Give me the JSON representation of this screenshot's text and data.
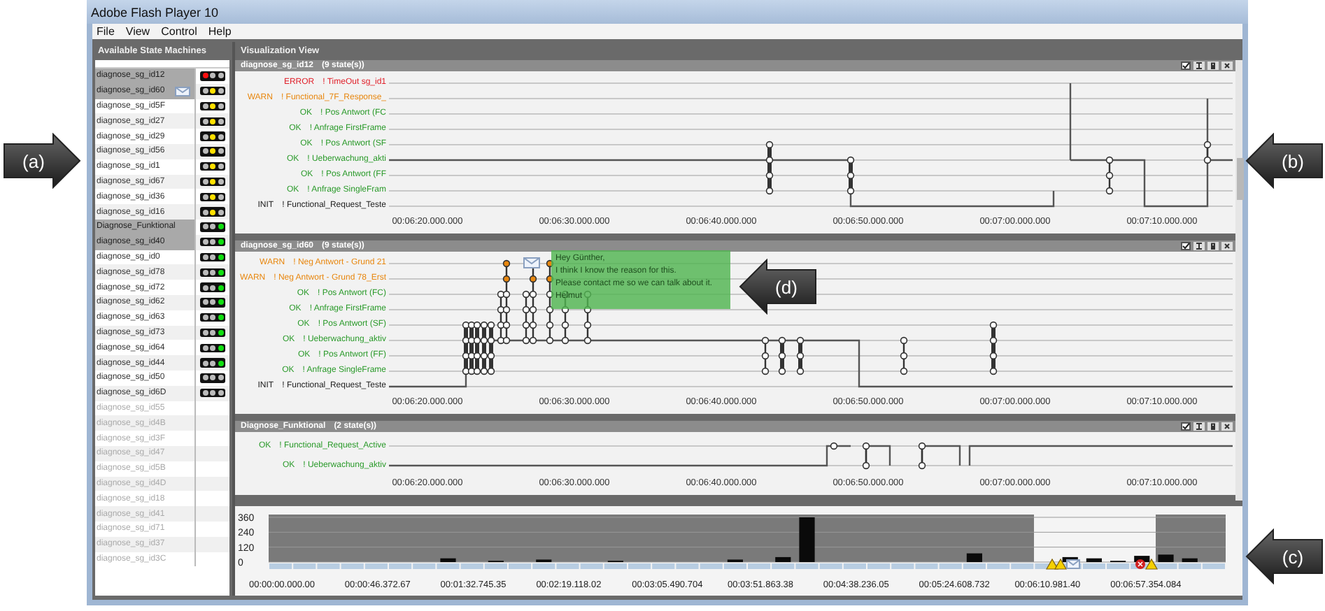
{
  "window": {
    "title": "Adobe Flash Player 10"
  },
  "menu": [
    "File",
    "View",
    "Control",
    "Help"
  ],
  "sidebar": {
    "title": "Available State Machines",
    "items": [
      {
        "name": "diagnose_sg_id12",
        "selected": true,
        "disabled": false,
        "message": false,
        "lights": [
          {
            "color": "#ff1010"
          },
          {
            "color": "#bbbbbb"
          },
          {
            "color": "#bbbbbb"
          }
        ]
      },
      {
        "name": "diagnose_sg_id60",
        "selected": true,
        "disabled": false,
        "message": true,
        "lights": [
          {
            "color": "#bbbbbb"
          },
          {
            "color": "#ffe000"
          },
          {
            "color": "#bbbbbb"
          }
        ]
      },
      {
        "name": "diagnose_sg_id5F",
        "selected": false,
        "disabled": false,
        "message": false,
        "lights": [
          {
            "color": "#bbbbbb"
          },
          {
            "color": "#ffe000"
          },
          {
            "color": "#bbbbbb"
          }
        ]
      },
      {
        "name": "diagnose_sg_id27",
        "selected": false,
        "disabled": false,
        "message": false,
        "lights": [
          {
            "color": "#bbbbbb"
          },
          {
            "color": "#ffe000"
          },
          {
            "color": "#bbbbbb"
          }
        ]
      },
      {
        "name": "diagnose_sg_id29",
        "selected": false,
        "disabled": false,
        "message": false,
        "lights": [
          {
            "color": "#bbbbbb"
          },
          {
            "color": "#ffe000"
          },
          {
            "color": "#bbbbbb"
          }
        ]
      },
      {
        "name": "diagnose_sg_id56",
        "selected": false,
        "disabled": false,
        "message": false,
        "lights": [
          {
            "color": "#bbbbbb"
          },
          {
            "color": "#ffe000"
          },
          {
            "color": "#bbbbbb"
          }
        ]
      },
      {
        "name": "diagnose_sg_id1",
        "selected": false,
        "disabled": false,
        "message": false,
        "lights": [
          {
            "color": "#bbbbbb"
          },
          {
            "color": "#ffe000"
          },
          {
            "color": "#bbbbbb"
          }
        ]
      },
      {
        "name": "diagnose_sg_id67",
        "selected": false,
        "disabled": false,
        "message": false,
        "lights": [
          {
            "color": "#bbbbbb"
          },
          {
            "color": "#ffe000"
          },
          {
            "color": "#bbbbbb"
          }
        ]
      },
      {
        "name": "diagnose_sg_id36",
        "selected": false,
        "disabled": false,
        "message": false,
        "lights": [
          {
            "color": "#bbbbbb"
          },
          {
            "color": "#ffe000"
          },
          {
            "color": "#bbbbbb"
          }
        ]
      },
      {
        "name": "diagnose_sg_id16",
        "selected": false,
        "disabled": false,
        "message": false,
        "lights": [
          {
            "color": "#bbbbbb"
          },
          {
            "color": "#ffe000"
          },
          {
            "color": "#bbbbbb"
          }
        ]
      },
      {
        "name": "Diagnose_Funktional",
        "selected": true,
        "disabled": false,
        "message": false,
        "lights": [
          {
            "color": "#bbbbbb"
          },
          {
            "color": "#bbbbbb"
          },
          {
            "color": "#10e010"
          }
        ]
      },
      {
        "name": "diagnose_sg_id40",
        "selected": true,
        "disabled": false,
        "message": false,
        "lights": [
          {
            "color": "#bbbbbb"
          },
          {
            "color": "#bbbbbb"
          },
          {
            "color": "#10e010"
          }
        ]
      },
      {
        "name": "diagnose_sg_id0",
        "selected": false,
        "disabled": false,
        "message": false,
        "lights": [
          {
            "color": "#bbbbbb"
          },
          {
            "color": "#bbbbbb"
          },
          {
            "color": "#10e010"
          }
        ]
      },
      {
        "name": "diagnose_sg_id78",
        "selected": false,
        "disabled": false,
        "message": false,
        "lights": [
          {
            "color": "#bbbbbb"
          },
          {
            "color": "#bbbbbb"
          },
          {
            "color": "#10e010"
          }
        ]
      },
      {
        "name": "diagnose_sg_id72",
        "selected": false,
        "disabled": false,
        "message": false,
        "lights": [
          {
            "color": "#bbbbbb"
          },
          {
            "color": "#bbbbbb"
          },
          {
            "color": "#10e010"
          }
        ]
      },
      {
        "name": "diagnose_sg_id62",
        "selected": false,
        "disabled": false,
        "message": false,
        "lights": [
          {
            "color": "#bbbbbb"
          },
          {
            "color": "#bbbbbb"
          },
          {
            "color": "#10e010"
          }
        ]
      },
      {
        "name": "diagnose_sg_id63",
        "selected": false,
        "disabled": false,
        "message": false,
        "lights": [
          {
            "color": "#bbbbbb"
          },
          {
            "color": "#bbbbbb"
          },
          {
            "color": "#10e010"
          }
        ]
      },
      {
        "name": "diagnose_sg_id73",
        "selected": false,
        "disabled": false,
        "message": false,
        "lights": [
          {
            "color": "#bbbbbb"
          },
          {
            "color": "#bbbbbb"
          },
          {
            "color": "#10e010"
          }
        ]
      },
      {
        "name": "diagnose_sg_id64",
        "selected": false,
        "disabled": false,
        "message": false,
        "lights": [
          {
            "color": "#bbbbbb"
          },
          {
            "color": "#bbbbbb"
          },
          {
            "color": "#10e010"
          }
        ]
      },
      {
        "name": "diagnose_sg_id44",
        "selected": false,
        "disabled": false,
        "message": false,
        "lights": [
          {
            "color": "#bbbbbb"
          },
          {
            "color": "#bbbbbb"
          },
          {
            "color": "#10e010"
          }
        ]
      },
      {
        "name": "diagnose_sg_id50",
        "selected": false,
        "disabled": false,
        "message": false,
        "lights": [
          {
            "color": "#bbbbbb"
          },
          {
            "color": "#bbbbbb"
          },
          {
            "color": "#bbbbbb"
          }
        ]
      },
      {
        "name": "diagnose_sg_id6D",
        "selected": false,
        "disabled": false,
        "message": false,
        "lights": [
          {
            "color": "#bbbbbb"
          },
          {
            "color": "#bbbbbb"
          },
          {
            "color": "#bbbbbb"
          }
        ]
      },
      {
        "name": "diagnose_sg_id55",
        "selected": false,
        "disabled": true,
        "message": false
      },
      {
        "name": "diagnose_sg_id4B",
        "selected": false,
        "disabled": true,
        "message": false
      },
      {
        "name": "diagnose_sg_id3F",
        "selected": false,
        "disabled": true,
        "message": false
      },
      {
        "name": "diagnose_sg_id47",
        "selected": false,
        "disabled": true,
        "message": false
      },
      {
        "name": "diagnose_sg_id5B",
        "selected": false,
        "disabled": true,
        "message": false
      },
      {
        "name": "diagnose_sg_id4D",
        "selected": false,
        "disabled": true,
        "message": false
      },
      {
        "name": "diagnose_sg_id18",
        "selected": false,
        "disabled": true,
        "message": false
      },
      {
        "name": "diagnose_sg_id41",
        "selected": false,
        "disabled": true,
        "message": false
      },
      {
        "name": "diagnose_sg_id71",
        "selected": false,
        "disabled": true,
        "message": false
      },
      {
        "name": "diagnose_sg_id37",
        "selected": false,
        "disabled": true,
        "message": false
      },
      {
        "name": "diagnose_sg_id3C",
        "selected": false,
        "disabled": true,
        "message": false
      }
    ]
  },
  "view": {
    "title": "Visualization View",
    "panels": [
      {
        "title": "diagnose_sg_id12",
        "count": "(9 state(s))",
        "lanes": [
          {
            "kind": "error",
            "level": "ERROR",
            "name": "! TimeOut sg_id1"
          },
          {
            "kind": "warn",
            "level": "WARN",
            "name": "! Functional_7F_Response_"
          },
          {
            "kind": "ok",
            "level": "OK",
            "name": "! Pos Antwort (FC"
          },
          {
            "kind": "ok",
            "level": "OK",
            "name": "! Anfrage FirstFrame"
          },
          {
            "kind": "ok",
            "level": "OK",
            "name": "! Pos Antwort (SF"
          },
          {
            "kind": "ok",
            "level": "OK",
            "name": "! Ueberwachung_akti"
          },
          {
            "kind": "ok",
            "level": "OK",
            "name": "! Pos Antwort (FF"
          },
          {
            "kind": "ok",
            "level": "OK",
            "name": "! Anfrage SingleFram"
          },
          {
            "kind": "init",
            "level": "INIT",
            "name": "! Functional_Request_Teste"
          }
        ],
        "ticks": [
          "00:06:20.000.000",
          "00:06:30.000.000",
          "00:06:40.000.000",
          "00:06:50.000.000",
          "00:07:00.000.000",
          "00:07:10.000.000"
        ]
      },
      {
        "title": "diagnose_sg_id60",
        "count": "(9 state(s))",
        "lanes": [
          {
            "kind": "warn",
            "level": "WARN",
            "name": "! Neg Antwort - Grund 21"
          },
          {
            "kind": "warn",
            "level": "WARN",
            "name": "! Neg Antwort - Grund 78_Erst"
          },
          {
            "kind": "ok",
            "level": "OK",
            "name": "! Pos Antwort (FC)"
          },
          {
            "kind": "ok",
            "level": "OK",
            "name": "! Anfrage FirstFrame"
          },
          {
            "kind": "ok",
            "level": "OK",
            "name": "! Pos Antwort (SF)"
          },
          {
            "kind": "ok",
            "level": "OK",
            "name": "! Ueberwachung_aktiv"
          },
          {
            "kind": "ok",
            "level": "OK",
            "name": "! Pos Antwort (FF)"
          },
          {
            "kind": "ok",
            "level": "OK",
            "name": "! Anfrage SingleFrame"
          },
          {
            "kind": "init",
            "level": "INIT",
            "name": "! Functional_Request_Teste"
          }
        ],
        "ticks": [
          "00:06:20.000.000",
          "00:06:30.000.000",
          "00:06:40.000.000",
          "00:06:50.000.000",
          "00:07:00.000.000",
          "00:07:10.000.000"
        ],
        "note": {
          "lines": [
            "Hey Günther,",
            "I think I know the reason for this.",
            "Please contact me so we can talk about it.",
            "Helmut"
          ]
        }
      },
      {
        "title": "Diagnose_Funktional",
        "count": "(2 state(s))",
        "lanes": [
          {
            "kind": "ok",
            "level": "OK",
            "name": "! Functional_Request_Active"
          },
          {
            "kind": "ok",
            "level": "OK",
            "name": "! Ueberwachung_aktiv"
          }
        ],
        "ticks": [
          "00:06:20.000.000",
          "00:06:30.000.000",
          "00:06:40.000.000",
          "00:06:50.000.000",
          "00:07:00.000.000",
          "00:07:10.000.000"
        ]
      }
    ]
  },
  "overview": {
    "chart_data": {
      "type": "bar",
      "categories": [
        "00:00:00.000.00",
        null,
        null,
        null,
        "00:00:46.372.67",
        null,
        null,
        null,
        "00:01:32.745.35",
        null,
        null,
        null,
        "00:02:19.118.02",
        null,
        null,
        null,
        "00:03:05.490.704",
        null,
        null,
        null,
        "00:03:51.863.38",
        null,
        null,
        null,
        "00:04:38.236.05",
        null,
        null,
        null,
        "00:05:24.608.732",
        null,
        null,
        null,
        "00:06:10.981.40",
        null,
        null,
        null,
        "00:06:57.354.084",
        null,
        null,
        null
      ],
      "values": [
        0,
        0,
        0,
        0,
        0,
        0,
        0,
        30,
        0,
        10,
        0,
        20,
        0,
        0,
        10,
        0,
        0,
        0,
        0,
        20,
        0,
        40,
        360,
        0,
        0,
        0,
        0,
        0,
        0,
        70,
        0,
        0,
        0,
        40,
        30,
        10,
        50,
        60,
        30,
        0
      ],
      "ylim": [
        0,
        360
      ],
      "yticks": [
        0,
        120,
        240,
        360
      ]
    }
  },
  "annotations": [
    {
      "label": "(a)",
      "kind": "right"
    },
    {
      "label": "(b)",
      "kind": "left"
    },
    {
      "label": "(c)",
      "kind": "left"
    },
    {
      "label": "(d)",
      "kind": "left"
    }
  ]
}
